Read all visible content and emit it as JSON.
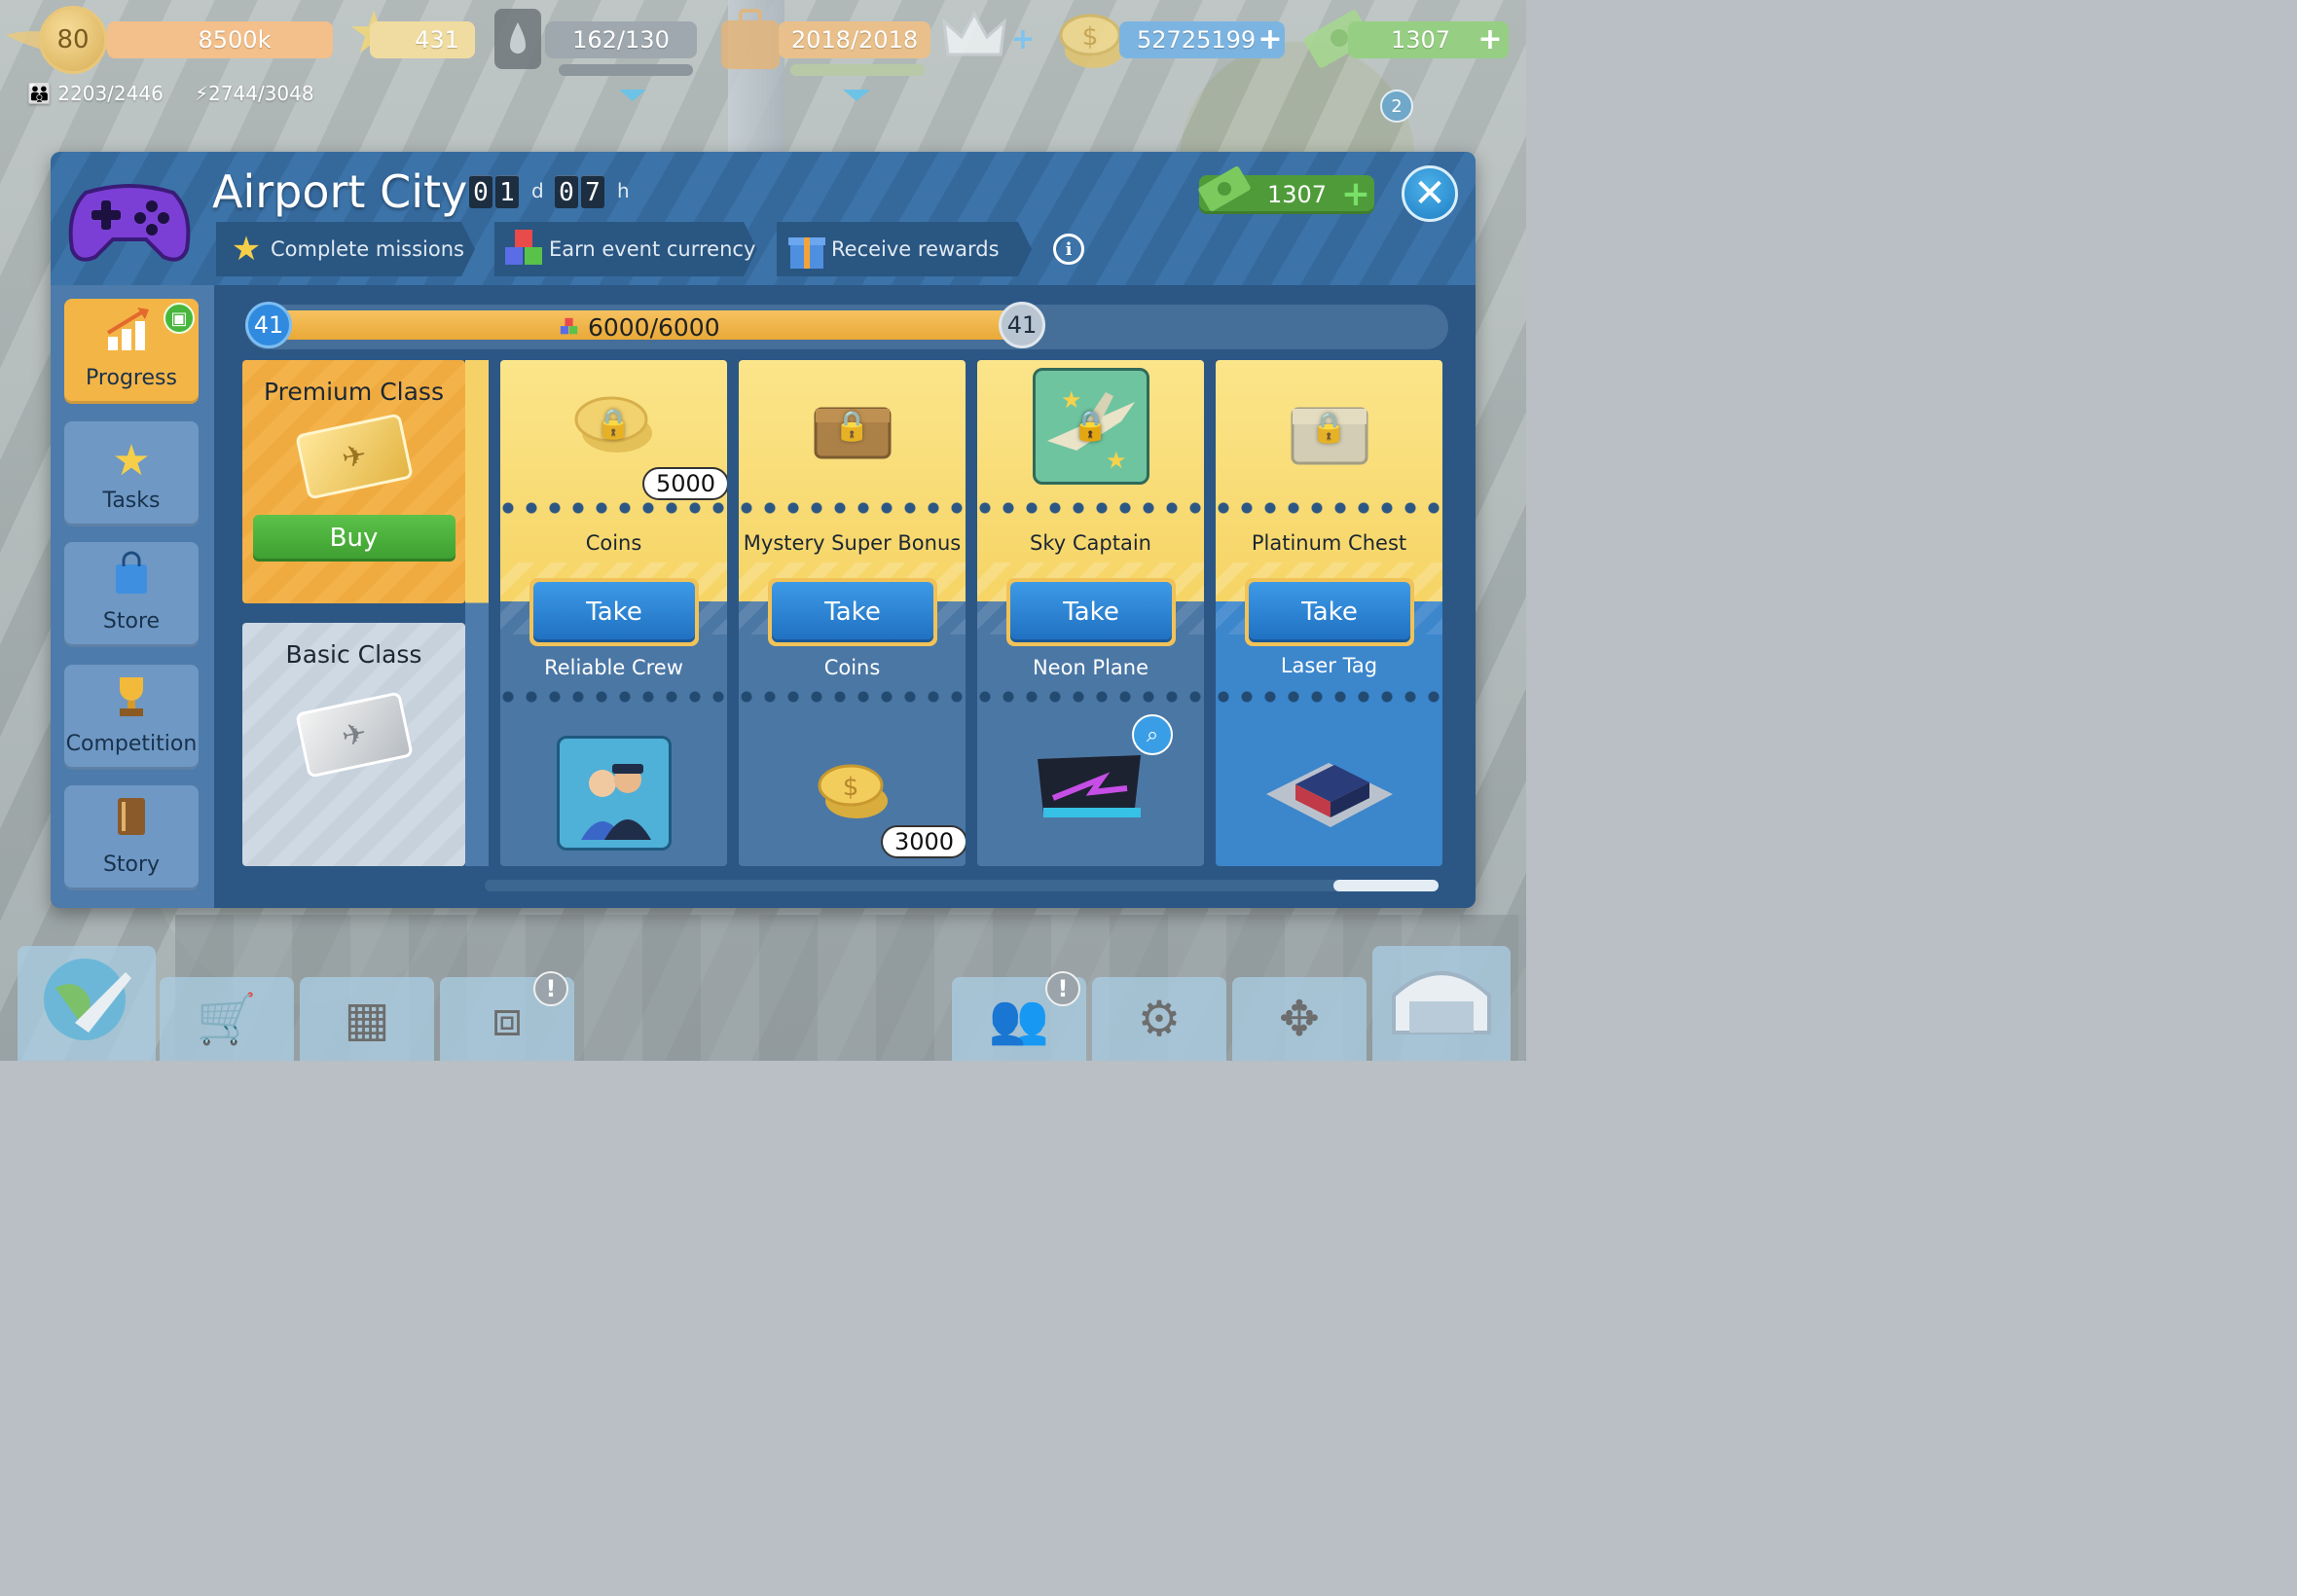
{
  "hud": {
    "level": "80",
    "xp": "8500k",
    "stars": "431",
    "fuel": "162/130",
    "cargo": "2018/2018",
    "coins": "52725199",
    "cash": "1307",
    "staff": "2203/2446",
    "power": "2744/3048",
    "notifications": "2"
  },
  "panel": {
    "title": "Airport City",
    "timer_days": [
      "0",
      "1"
    ],
    "timer_days_unit": "d",
    "timer_hours": [
      "0",
      "7"
    ],
    "timer_hours_unit": "h",
    "currency_value": "1307",
    "steps": [
      {
        "label": "Complete missions",
        "icon": "star-icon"
      },
      {
        "label": "Earn event currency",
        "icon": "cubes-icon"
      },
      {
        "label": "Receive rewards",
        "icon": "gift-icon"
      }
    ]
  },
  "sidebar": {
    "items": [
      {
        "label": "Progress",
        "icon": "progress-chart-icon",
        "active": true
      },
      {
        "label": "Tasks",
        "icon": "star-icon"
      },
      {
        "label": "Store",
        "icon": "shopping-bag-icon"
      },
      {
        "label": "Competition",
        "icon": "trophy-icon"
      },
      {
        "label": "Story",
        "icon": "book-icon"
      }
    ]
  },
  "progress": {
    "level_left": "41",
    "level_right": "41",
    "text": "6000/6000",
    "fraction": 1.0
  },
  "tiers": {
    "premium": {
      "name": "Premium Class",
      "buy_label": "Buy"
    },
    "basic": {
      "name": "Basic Class"
    }
  },
  "rewards": [
    {
      "premium_name": "Coins",
      "premium_qty": "5000",
      "take_label": "Take",
      "basic_name": "Reliable Crew",
      "basic_qty": ""
    },
    {
      "premium_name": "Mystery Super Bonus",
      "premium_qty": "",
      "take_label": "Take",
      "basic_name": "Coins",
      "basic_qty": "3000"
    },
    {
      "premium_name": "Sky Captain",
      "premium_qty": "",
      "take_label": "Take",
      "basic_name": "Neon Plane",
      "basic_qty": ""
    },
    {
      "premium_name": "Platinum Chest",
      "premium_qty": "",
      "take_label": "Take",
      "basic_name": "Laser Tag",
      "basic_qty": ""
    }
  ],
  "colors": {
    "panel": "#2f5f8c",
    "accent_gold": "#f4b547",
    "take_blue": "#1f6fc0",
    "buy_green": "#3c9e2f"
  }
}
